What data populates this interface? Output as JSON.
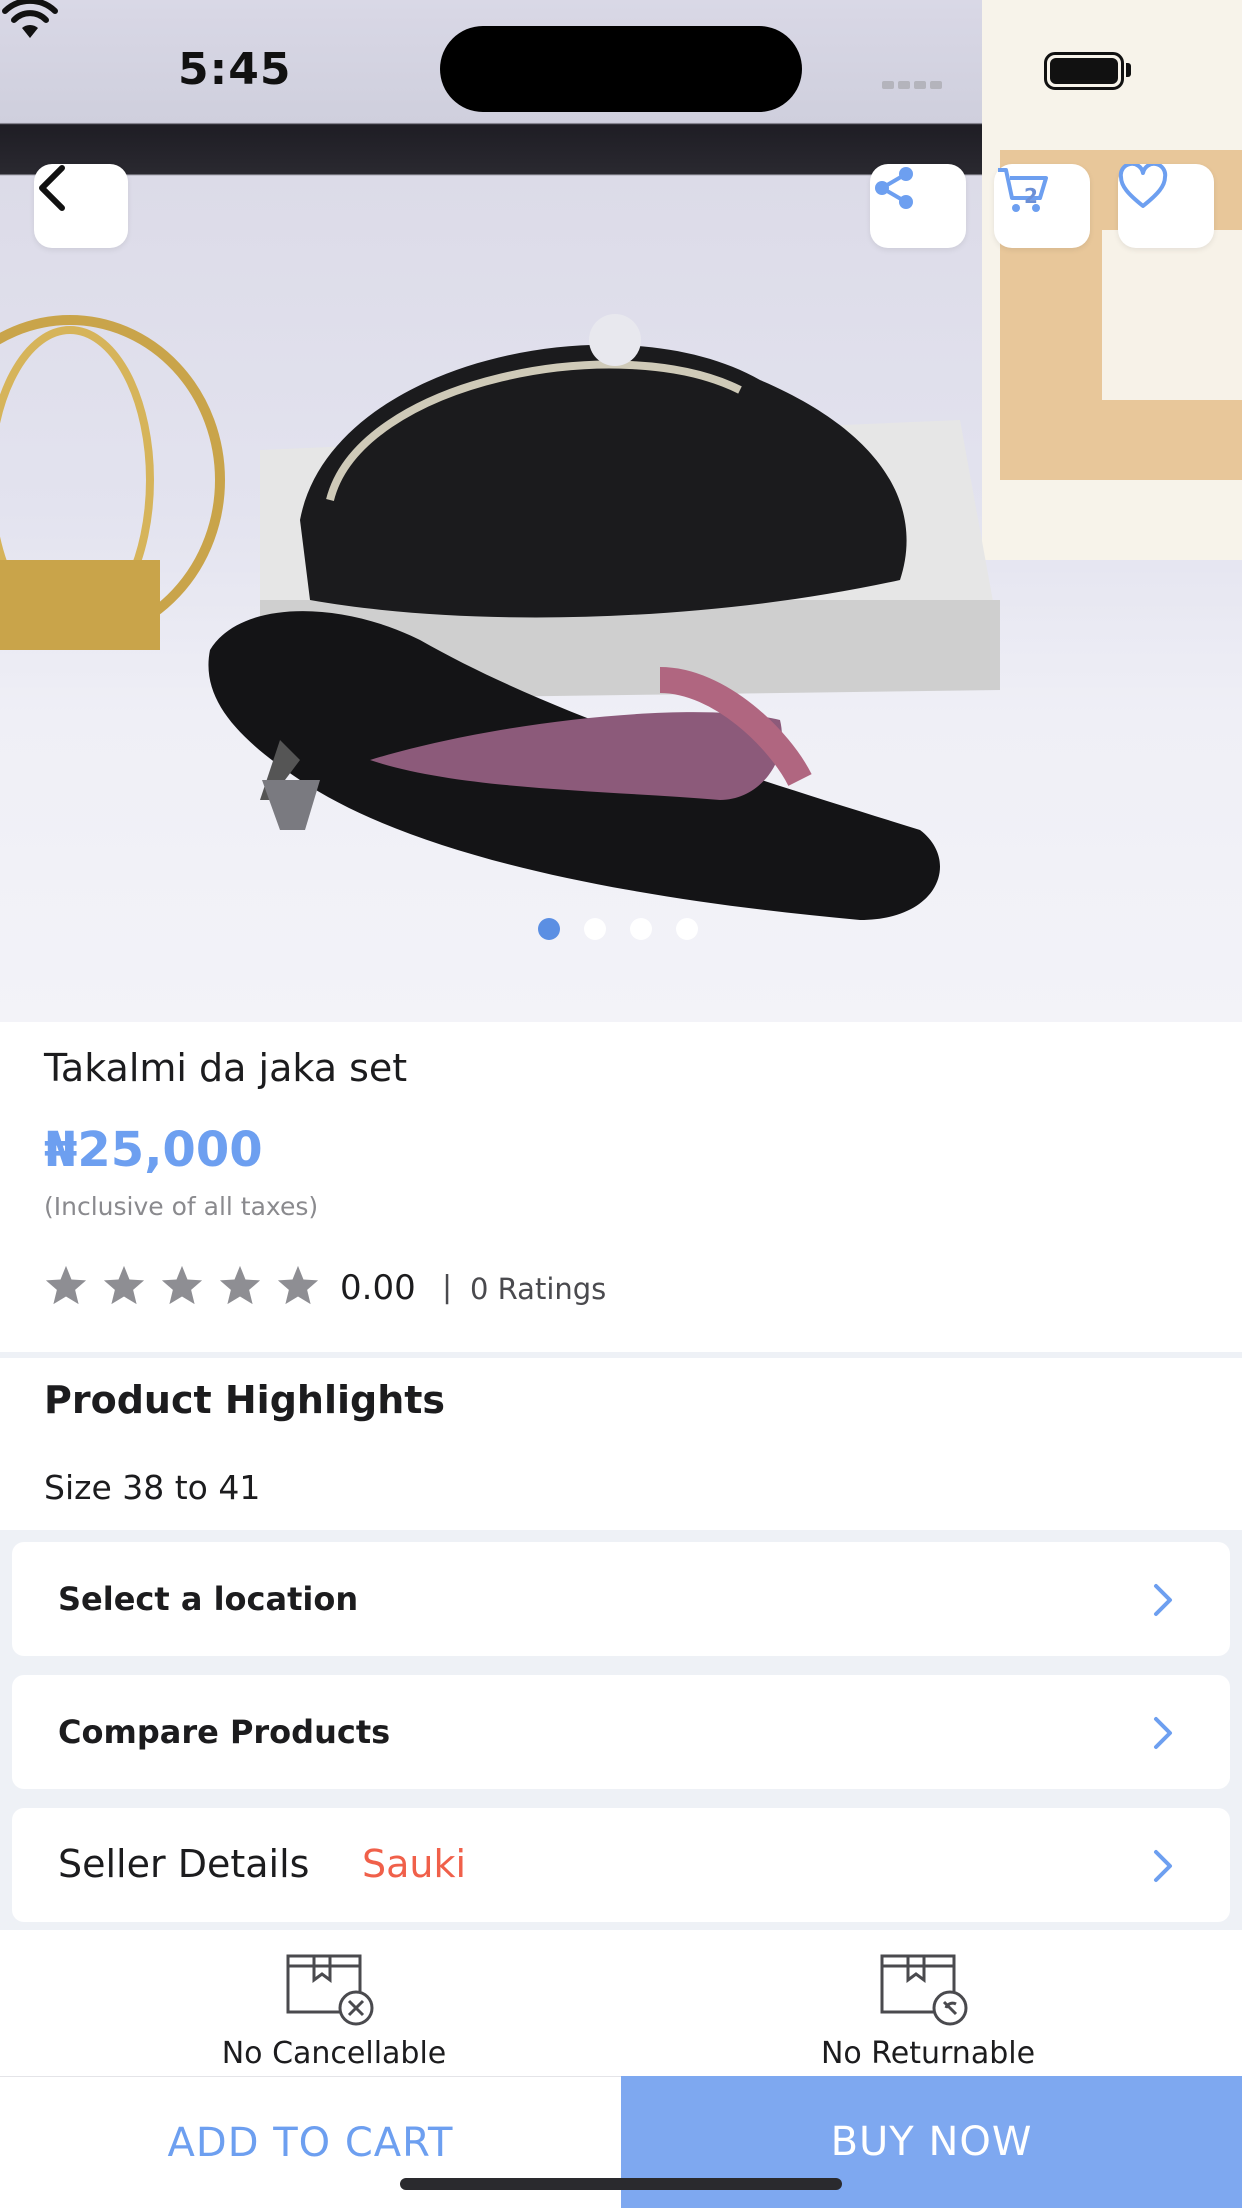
{
  "status": {
    "time": "5:45"
  },
  "header": {
    "cart_count": "2"
  },
  "carousel": {
    "total": 4,
    "active_index": 0
  },
  "product": {
    "title": "Takalmi da jaka set",
    "price": "₦25,000",
    "tax_note": "(Inclusive of all taxes)",
    "rating_value": "0.00",
    "rating_separator": "|",
    "ratings_count": "0 Ratings",
    "stars_filled": 0,
    "stars_total": 5
  },
  "highlights": {
    "title": "Product Highlights",
    "text": "Size 38 to 41"
  },
  "rows": {
    "location": "Select a location",
    "compare": "Compare Products",
    "seller_label": "Seller Details",
    "seller_name": "Sauki"
  },
  "policies": {
    "cancel": "No Cancellable",
    "return": "No Returnable"
  },
  "actions": {
    "add_to_cart": "ADD TO CART",
    "buy_now": "BUY NOW"
  },
  "colors": {
    "accent": "#6d9ff0",
    "buy_now_bg": "#7ea8f0",
    "seller": "#f0604a",
    "star": "#8e8e93"
  },
  "icons": [
    "back-icon",
    "share-icon",
    "cart-icon",
    "heart-icon",
    "star-icon",
    "chevron-right-icon",
    "box-cancel-icon",
    "box-no-return-icon"
  ]
}
